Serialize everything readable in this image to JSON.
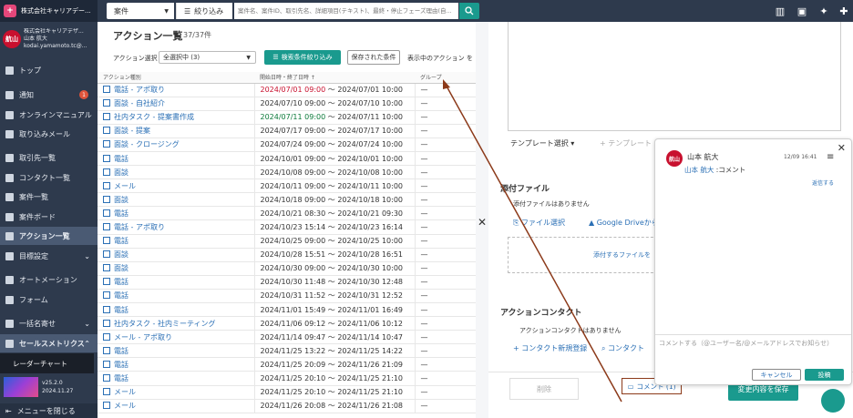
{
  "company": "株式会社キャリアデー...",
  "user": {
    "company": "株式会社キャリアデザ...",
    "name": "山本 航大",
    "email": "kodai.yamamoto.tc@...",
    "avatar_text": "航山"
  },
  "sidebar": {
    "items": [
      {
        "label": "トップ",
        "icon": "home-icon"
      },
      {
        "label": "通知",
        "icon": "bell-icon",
        "badge": "1"
      },
      {
        "label": "オンラインマニュアル",
        "icon": "help-icon"
      },
      {
        "label": "取り込みメール",
        "icon": "mail-icon"
      },
      {
        "label": "取引先一覧",
        "icon": "building-icon"
      },
      {
        "label": "コンタクト一覧",
        "icon": "contact-icon"
      },
      {
        "label": "案件一覧",
        "icon": "briefcase-icon"
      },
      {
        "label": "案件ボード",
        "icon": "board-icon"
      },
      {
        "label": "アクション一覧",
        "icon": "action-icon"
      },
      {
        "label": "目標設定",
        "icon": "flag-icon"
      },
      {
        "label": "オートメーション",
        "icon": "automation-icon"
      },
      {
        "label": "フォーム",
        "icon": "form-icon"
      },
      {
        "label": "一括名寄せ",
        "icon": "merge-icon"
      },
      {
        "label": "セールスメトリクス",
        "icon": "metrics-icon"
      }
    ],
    "radar_label": "レーダーチャート",
    "version": "v25.2.0",
    "version_date": "2024.11.27",
    "close_menu": "メニューを閉じる"
  },
  "topbar": {
    "search_type": "案件",
    "filter_label": "絞り込み",
    "search_placeholder": "案件名、案件ID、取引先名、詳細項目(テキスト)、最終・停止フェーズ理由(自..."
  },
  "list": {
    "title": "アクション一覧",
    "count": "37/37件",
    "select_label": "アクション選択",
    "select_value": "全選択中 (3)",
    "narrow_button": "検索条件絞り込み",
    "saved_button": "保存された条件",
    "show_label": "表示中のアクション を",
    "headers": [
      "アクション種別",
      "開始日時・終了日時 ↑",
      "グループ"
    ],
    "rows": [
      {
        "type": "電話 - アポ取り",
        "start": "2024/07/01 09:00",
        "end": "2024/07/01 10:00",
        "group": "—"
      },
      {
        "type": "面談 - 自社紹介",
        "start": "2024/07/10 09:00",
        "end": "2024/07/10 10:00",
        "group": "—"
      },
      {
        "type": "社内タスク - 提案書作成",
        "start": "2024/07/11 09:00",
        "end": "2024/07/11 10:00",
        "group": "—"
      },
      {
        "type": "面談 - 提案",
        "start": "2024/07/17 09:00",
        "end": "2024/07/17 10:00",
        "group": "—"
      },
      {
        "type": "面談 - クロージング",
        "start": "2024/07/24 09:00",
        "end": "2024/07/24 10:00",
        "group": "—"
      },
      {
        "type": "電話",
        "start": "2024/10/01 09:00",
        "end": "2024/10/01 10:00",
        "group": "—"
      },
      {
        "type": "面談",
        "start": "2024/10/08 09:00",
        "end": "2024/10/08 10:00",
        "group": "—"
      },
      {
        "type": "メール",
        "start": "2024/10/11 09:00",
        "end": "2024/10/11 10:00",
        "group": "—"
      },
      {
        "type": "面談",
        "start": "2024/10/18 09:00",
        "end": "2024/10/18 10:00",
        "group": "—"
      },
      {
        "type": "電話",
        "start": "2024/10/21 08:30",
        "end": "2024/10/21 09:30",
        "group": "—"
      },
      {
        "type": "電話 - アポ取り",
        "start": "2024/10/23 15:14",
        "end": "2024/10/23 16:14",
        "group": "—"
      },
      {
        "type": "電話",
        "start": "2024/10/25 09:00",
        "end": "2024/10/25 10:00",
        "group": "—"
      },
      {
        "type": "面談",
        "start": "2024/10/28 15:51",
        "end": "2024/10/28 16:51",
        "group": "—"
      },
      {
        "type": "面談",
        "start": "2024/10/30 09:00",
        "end": "2024/10/30 10:00",
        "group": "—"
      },
      {
        "type": "電話",
        "start": "2024/10/30 11:48",
        "end": "2024/10/30 12:48",
        "group": "—"
      },
      {
        "type": "電話",
        "start": "2024/10/31 11:52",
        "end": "2024/10/31 12:52",
        "group": "—"
      },
      {
        "type": "電話",
        "start": "2024/11/01 15:49",
        "end": "2024/11/01 16:49",
        "group": "—"
      },
      {
        "type": "社内タスク - 社内ミーティング",
        "start": "2024/11/06 09:12",
        "end": "2024/11/06 10:12",
        "group": "—"
      },
      {
        "type": "メール - アポ取り",
        "start": "2024/11/14 09:47",
        "end": "2024/11/14 10:47",
        "group": "—"
      },
      {
        "type": "電話",
        "start": "2024/11/25 13:22",
        "end": "2024/11/25 14:22",
        "group": "—"
      },
      {
        "type": "電話",
        "start": "2024/11/25 20:09",
        "end": "2024/11/26 21:09",
        "group": "—"
      },
      {
        "type": "電話",
        "start": "2024/11/25 20:10",
        "end": "2024/11/25 21:10",
        "group": "—"
      },
      {
        "type": "メール",
        "start": "2024/11/25 20:10",
        "end": "2024/11/25 21:10",
        "group": "—"
      },
      {
        "type": "メール",
        "start": "2024/11/26 20:08",
        "end": "2024/11/26 21:08",
        "group": "—"
      }
    ]
  },
  "detail": {
    "template_label": "テンプレート選択 ▾",
    "template_add": "+ テンプレート",
    "attach_heading": "添付ファイル",
    "attach_none": "添付ファイルはありません",
    "file_select": "ファイル選択",
    "gdrive": "Google Driveから",
    "dropzone": "添付するファイルを",
    "contact_heading": "アクションコンタクト",
    "contact_none": "アクションコンタクトはありません",
    "contact_new": "+ コンタクト新規登録",
    "contact_search": "コンタクト",
    "delete_button": "削除",
    "comment_button": "コメント (1)",
    "save_button": "変更内容を保存"
  },
  "popup": {
    "author": "山本 航大",
    "date": "12/09 16:41",
    "mention": "山本 航大",
    "message": " :コメント",
    "reply": "返信する",
    "input_placeholder": "コメントする（@ユーザー名/@メールアドレスでお知らせ）",
    "cancel": "キャンセル",
    "post": "投稿"
  },
  "colors": {
    "accent": "#1a9a8e",
    "sidebar": "#2e3a4d",
    "annotation": "#8c3a1a",
    "link": "#2a6fb5"
  }
}
